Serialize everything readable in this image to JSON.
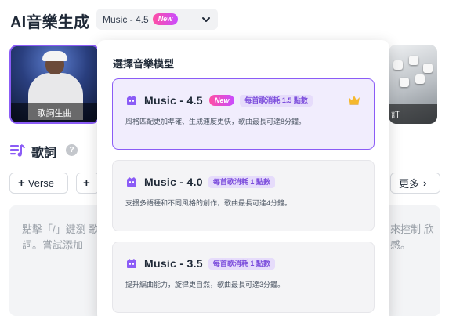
{
  "header": {
    "title": "AI音樂生成",
    "model_select": {
      "label": "Music - 4.5",
      "badge": "New"
    }
  },
  "cards": [
    {
      "label": "歌詞生曲",
      "selected": true
    },
    {
      "label": "訂",
      "selected": false
    }
  ],
  "lyrics": {
    "title": "歌詞",
    "help": "?",
    "chips": {
      "verse": "Verse",
      "more": "更多"
    },
    "placeholder_left": "點擊「/」鍵瀏 歌詞。嘗試添加",
    "placeholder_right": "來控制 欣感。"
  },
  "dropdown": {
    "title": "選擇音樂模型",
    "options": [
      {
        "name": "Music - 4.5",
        "badge": "New",
        "cost": "每首歌消耗 1.5 點數",
        "desc": "風格匹配更加準確、生成速度更快，歌曲最長可達8分鐘。",
        "selected": true,
        "premium": true
      },
      {
        "name": "Music - 4.0",
        "cost": "每首歌消耗 1 點數",
        "desc": "支援多語種和不同風格的創作，歌曲最長可達4分鐘。",
        "selected": false
      },
      {
        "name": "Music - 3.5",
        "cost": "每首歌消耗 1 點數",
        "desc": "提升編曲能力，旋律更自然，歌曲最長可達3分鐘。",
        "selected": false
      }
    ]
  },
  "colors": {
    "accent": "#8b5cf6",
    "badge_from": "#ff4fa3",
    "badge_to": "#c84dff",
    "crown": "#f5b82e"
  },
  "icons": [
    "chevron-down-icon",
    "music-list-icon",
    "help-icon",
    "plus-icon",
    "chevron-right-icon",
    "model-icon",
    "crown-icon"
  ]
}
